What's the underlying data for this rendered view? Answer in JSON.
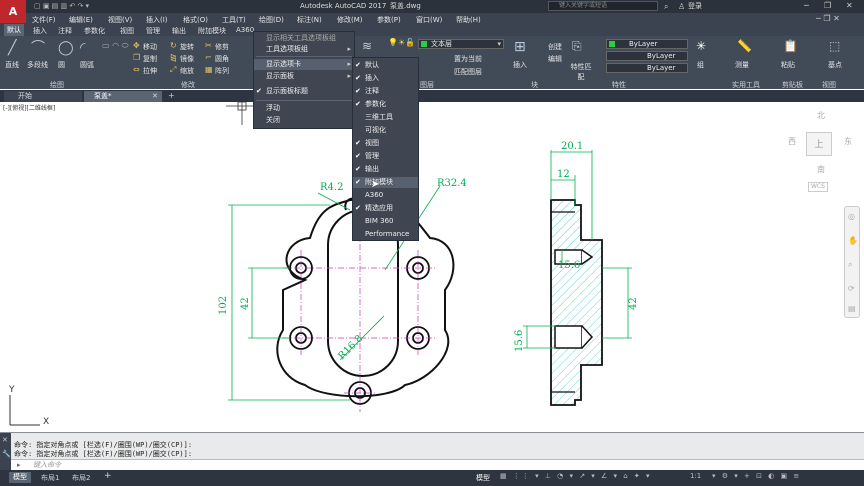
{
  "app": {
    "title": "Autodesk AutoCAD 2017",
    "file": "泵盖.dwg",
    "app_button": "A",
    "search_placeholder": "键入关键字或短语",
    "login": "登录"
  },
  "menu": [
    "文件(F)",
    "编辑(E)",
    "视图(V)",
    "插入(I)",
    "格式(O)",
    "工具(T)",
    "绘图(D)",
    "标注(N)",
    "修改(M)",
    "参数(P)",
    "窗口(W)",
    "帮助(H)"
  ],
  "ribbon_tabs": [
    "默认",
    "插入",
    "注释",
    "参数化",
    "视图",
    "管理",
    "输出",
    "附加模块",
    "A360",
    "精选"
  ],
  "ribbon": {
    "draw": {
      "line": "直线",
      "polyline": "多段线",
      "circle": "圆",
      "arc": "圆弧",
      "panel": "绘图"
    },
    "modify": {
      "move": "移动",
      "rotate": "旋转",
      "trim": "修剪",
      "copy": "复制",
      "mirror": "镜像",
      "fillet": "圆角",
      "stretch": "拉伸",
      "scale": "缩放",
      "array": "阵列",
      "panel": "修改"
    },
    "annotation": {
      "text_style": "文本层",
      "panel": "图层"
    },
    "layer": {
      "set_current": "置为当前",
      "match": "匹配图层"
    },
    "block": {
      "insert": "插入",
      "create": "创建",
      "edit": "编辑",
      "panel": "块"
    },
    "properties": {
      "match": "特性匹配",
      "bylayer1": "ByLayer",
      "bylayer2": "ByLayer",
      "bylayer3": "ByLayer",
      "panel": "特性"
    },
    "groups": {
      "group": "组"
    },
    "utilities": {
      "measure": "测量",
      "panel": "实用工具"
    },
    "clipboard": {
      "paste": "粘贴",
      "panel": "剪贴板"
    },
    "view": {
      "basepoint": "基点",
      "panel": "视图"
    }
  },
  "context_menu": {
    "items": [
      "显示相关工具选项板组",
      "工具选项板组",
      "显示选项卡",
      "显示面板",
      "显示面板标题",
      "浮动",
      "关闭"
    ]
  },
  "submenu": {
    "items": [
      {
        "label": "默认",
        "checked": true
      },
      {
        "label": "插入",
        "checked": true
      },
      {
        "label": "注释",
        "checked": true
      },
      {
        "label": "参数化",
        "checked": true
      },
      {
        "label": "三维工具",
        "checked": false
      },
      {
        "label": "可视化",
        "checked": false
      },
      {
        "label": "视图",
        "checked": true
      },
      {
        "label": "管理",
        "checked": true
      },
      {
        "label": "输出",
        "checked": true
      },
      {
        "label": "附加模块",
        "checked": true
      },
      {
        "label": "A360",
        "checked": false
      },
      {
        "label": "精选应用",
        "checked": true
      },
      {
        "label": "BIM 360",
        "checked": false
      },
      {
        "label": "Performance",
        "checked": false
      }
    ]
  },
  "file_tabs": {
    "start": "开始",
    "drawing": "泵盖*"
  },
  "viewport_label": "[-][俯视][二维线框]",
  "viewcube": {
    "north": "北",
    "south": "南",
    "east": "东",
    "west": "西",
    "top": "上",
    "wcs": "WCS"
  },
  "drawing": {
    "r42": "R4.2",
    "r324": "R32.4",
    "r168": "R16.8",
    "d102": "102",
    "d42a": "42",
    "d201": "20.1",
    "d12": "12",
    "d156": "15.6",
    "d42b": "42",
    "d156b": "15.6",
    "ucs_x": "X",
    "ucs_y": "Y"
  },
  "command": {
    "line1": "命令: 指定对角点或 [栏选(F)/圈围(WP)/圈交(CP)]:",
    "line2": "命令: 指定对角点或 [栏选(F)/圈围(WP)/圈交(CP)]:",
    "prompt": "键入命令"
  },
  "layout_tabs": [
    "模型",
    "布局1",
    "布局2"
  ],
  "status": {
    "model": "模型",
    "scale": "1:1"
  },
  "colors": {
    "accent": "#c0272d",
    "dim_green": "#00b050",
    "hatch": "#3ec7c7",
    "center_magenta": "#cc33cc"
  }
}
